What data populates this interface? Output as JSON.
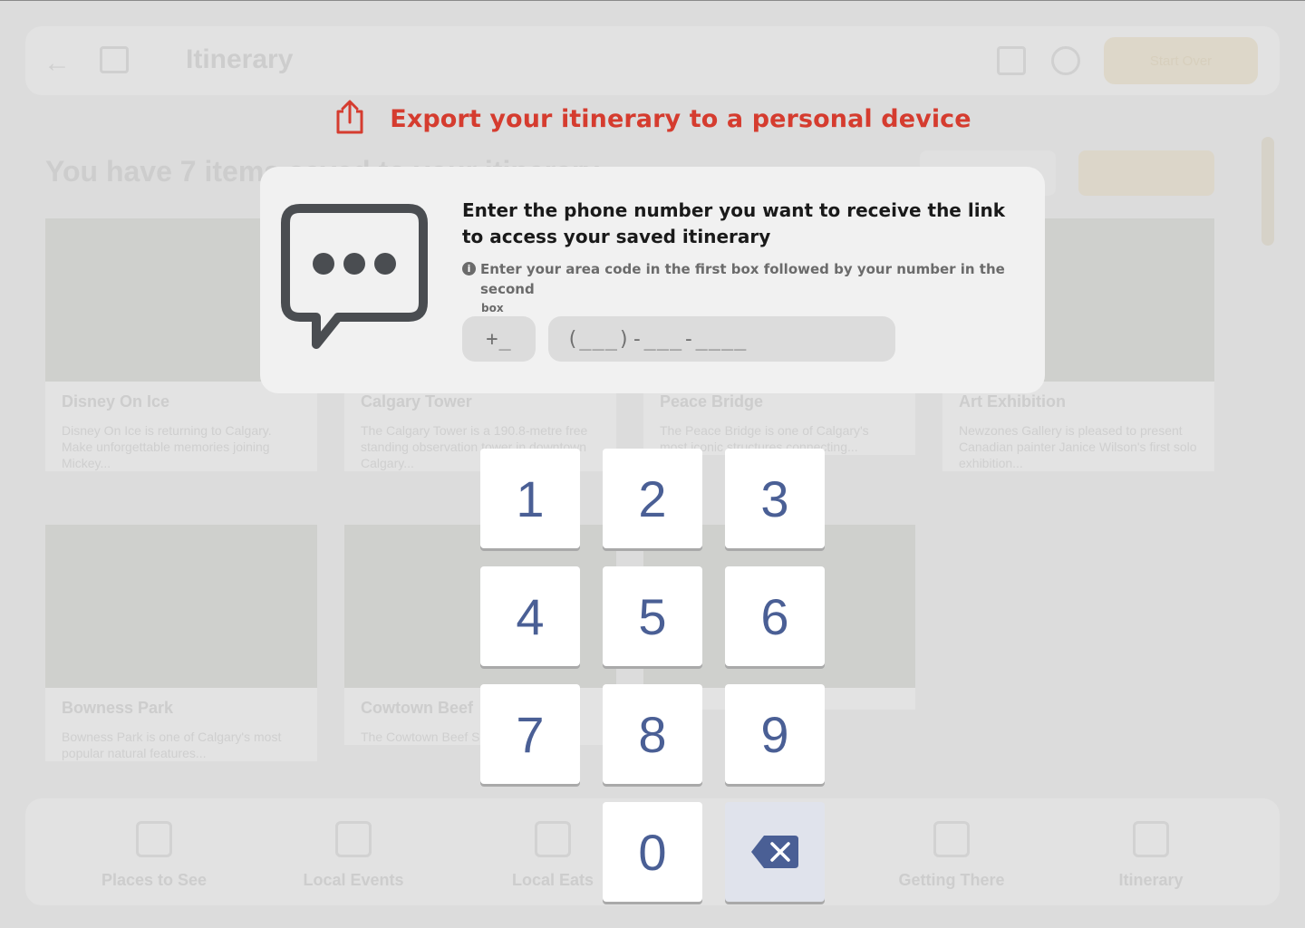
{
  "background": {
    "header_title": "Itinerary",
    "start_over": "Start Over",
    "heading": "You have 7 items saved to your itinerary",
    "cards": [
      {
        "name": "Disney On Ice",
        "desc": "Disney On Ice is returning to Calgary. Make unforgettable memories joining Mickey..."
      },
      {
        "name": "Calgary Tower",
        "desc": "The Calgary Tower is a 190.8-metre free standing observation tower in downtown Calgary..."
      },
      {
        "name": "Peace Bridge",
        "desc": "The Peace Bridge is one of Calgary's most iconic structures connecting..."
      },
      {
        "name": "Art Exhibition",
        "desc": "Newzones Gallery is pleased to present Canadian painter Janice Wilson's first solo exhibition..."
      },
      {
        "name": "Bowness Park",
        "desc": "Bowness Park is one of Calgary's most popular natural features..."
      },
      {
        "name": "Cowtown Beef",
        "desc": "The Cowtown Beef Shack is a small..."
      },
      {
        "name": "",
        "desc": ""
      }
    ],
    "nav": [
      "Places to See",
      "Local Events",
      "Local Eats",
      "Getting There",
      "Itinerary"
    ]
  },
  "modal": {
    "title": "Export your itinerary to a personal device",
    "prompt": "Enter the phone number you want to receive the link to access your saved itinerary",
    "hint": "Enter your area code in the first box followed by your number in the second",
    "hint_tail": "box",
    "area_code_placeholder": "+_",
    "number_placeholder": "(___)-___-____"
  },
  "keypad": {
    "keys": [
      "1",
      "2",
      "3",
      "4",
      "5",
      "6",
      "7",
      "8",
      "9",
      "0"
    ],
    "delete_icon": "backspace-icon",
    "digit_color": "#4a5f95"
  },
  "colors": {
    "accent": "#d53c2f",
    "panel": "#f1f1f1",
    "field": "#dcdcdc"
  }
}
